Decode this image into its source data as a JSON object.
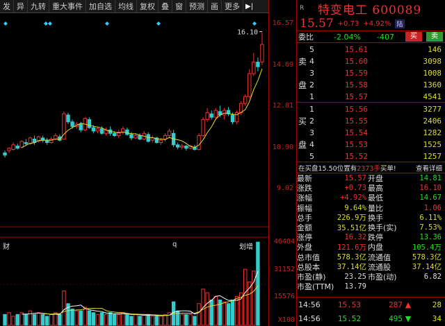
{
  "toolbar": {
    "items": [
      "发",
      "异",
      "九转",
      "重大事件",
      "加自选",
      "均线",
      "复权",
      "叠",
      "窗",
      "预测",
      "画",
      "更多"
    ],
    "arrow": "▶|"
  },
  "axis": {
    "price_ticks": [
      "16.57",
      "14.69",
      "12.81",
      "10.90",
      "9.02"
    ],
    "volume_ticks": [
      "46404",
      "31152",
      "15576"
    ],
    "volume_unit": "X100",
    "high_marker": "16.10"
  },
  "events": [
    "财",
    "q",
    "划增"
  ],
  "header": {
    "r_label": "R",
    "name": "特变电工",
    "code": "600089",
    "price": "15.57",
    "change": "+0.73",
    "change_pct": "+4.92%",
    "badge": "陆"
  },
  "weibi": {
    "label": "委比",
    "pct": "-2.04%",
    "diff": "-407",
    "buy": "买",
    "sell": "卖"
  },
  "orderbook": {
    "ask_side": [
      "卖",
      "盘"
    ],
    "bid_side": [
      "买",
      "盘"
    ],
    "asks": [
      {
        "lvl": "5",
        "price": "15.61",
        "vol": "146"
      },
      {
        "lvl": "4",
        "price": "15.60",
        "vol": "3098"
      },
      {
        "lvl": "3",
        "price": "15.59",
        "vol": "1008"
      },
      {
        "lvl": "2",
        "price": "15.58",
        "vol": "1360"
      },
      {
        "lvl": "1",
        "price": "15.57",
        "vol": "4541"
      }
    ],
    "bids": [
      {
        "lvl": "1",
        "price": "15.56",
        "vol": "3277"
      },
      {
        "lvl": "2",
        "price": "15.55",
        "vol": "2406"
      },
      {
        "lvl": "3",
        "price": "15.54",
        "vol": "1282"
      },
      {
        "lvl": "4",
        "price": "15.53",
        "vol": "1525"
      },
      {
        "lvl": "5",
        "price": "15.52",
        "vol": "1257"
      }
    ]
  },
  "inner": {
    "prefix": "在买盘15.50位置有",
    "qty": "2373手",
    "suffix": "买单!",
    "link": "查看详细"
  },
  "stats": [
    {
      "k": "最新",
      "v": "15.57",
      "vc": "red",
      "k2": "开盘",
      "v2": "14.81",
      "v2c": "green"
    },
    {
      "k": "涨跌",
      "v": "+0.73",
      "vc": "red",
      "k2": "最高",
      "v2": "16.10",
      "v2c": "red"
    },
    {
      "k": "涨幅",
      "v": "+4.92%",
      "vc": "red",
      "k2": "最低",
      "v2": "14.67",
      "v2c": "green"
    },
    {
      "k": "振幅",
      "v": "9.64%",
      "vc": "yellow",
      "k2": "量比",
      "v2": "1.06",
      "v2c": "red"
    },
    {
      "k": "总手",
      "v": "226.9万",
      "vc": "yellow",
      "k2": "换手",
      "v2": "6.11%",
      "v2c": "yellow"
    },
    {
      "k": "金额",
      "v": "35.51亿",
      "vc": "yellow",
      "k2": "换手(实)",
      "v2": "7.53%",
      "v2c": "yellow"
    },
    {
      "k": "涨停",
      "v": "16.32",
      "vc": "red",
      "k2": "跌停",
      "v2": "13.36",
      "v2c": "green"
    },
    {
      "k": "外盘",
      "v": "121.6万",
      "vc": "red",
      "k2": "内盘",
      "v2": "105.4万",
      "v2c": "green"
    },
    {
      "k": "总市值",
      "v": "578.3亿",
      "vc": "yellow",
      "k2": "流通值",
      "v2": "578.3亿",
      "v2c": "yellow"
    },
    {
      "k": "总股本",
      "v": "37.14亿",
      "vc": "yellow",
      "k2": "流通股",
      "v2": "37.14亿",
      "v2c": "yellow"
    },
    {
      "k": "市盈(静)",
      "v": "23.25",
      "vc": "white",
      "k2": "市盈(动)",
      "v2": "6.82",
      "v2c": "white"
    },
    {
      "k": "市盈(TTM)",
      "v": "13.79",
      "vc": "white",
      "k2": "",
      "v2": "",
      "v2c": "white"
    }
  ],
  "ticks": [
    {
      "t": "14:56",
      "p": "15.53",
      "v": "287",
      "dir": "up",
      "n": "28"
    },
    {
      "t": "14:56",
      "p": "15.52",
      "v": "495",
      "dir": "down",
      "n": "34"
    }
  ],
  "colors": {
    "up": "#e33",
    "down": "#2d2",
    "ma": "#dd3",
    "ma2": "#fff",
    "accent": "#a00"
  },
  "chart_data": {
    "type": "candlestick",
    "price_range": [
      9.02,
      16.57
    ],
    "volume_range": [
      0,
      46404
    ],
    "candles": [
      {
        "o": 10.85,
        "c": 10.75,
        "h": 10.95,
        "l": 10.65
      },
      {
        "o": 10.95,
        "c": 11.05,
        "h": 11.1,
        "l": 10.85
      },
      {
        "o": 11.0,
        "c": 11.2,
        "h": 11.3,
        "l": 10.95
      },
      {
        "o": 11.15,
        "c": 11.05,
        "h": 11.25,
        "l": 11.0
      },
      {
        "o": 11.1,
        "c": 11.35,
        "h": 11.4,
        "l": 11.05
      },
      {
        "o": 11.3,
        "c": 11.25,
        "h": 11.45,
        "l": 11.15
      },
      {
        "o": 11.25,
        "c": 11.5,
        "h": 11.55,
        "l": 11.2
      },
      {
        "o": 11.45,
        "c": 11.3,
        "h": 11.6,
        "l": 11.2
      },
      {
        "o": 11.35,
        "c": 11.55,
        "h": 11.6,
        "l": 11.3
      },
      {
        "o": 11.5,
        "c": 11.4,
        "h": 11.6,
        "l": 11.3
      },
      {
        "o": 11.4,
        "c": 11.3,
        "h": 11.5,
        "l": 11.2
      },
      {
        "o": 11.3,
        "c": 11.45,
        "h": 11.55,
        "l": 11.25
      },
      {
        "o": 11.45,
        "c": 11.6,
        "h": 11.7,
        "l": 11.4
      },
      {
        "o": 11.55,
        "c": 11.4,
        "h": 11.65,
        "l": 11.35
      },
      {
        "o": 11.45,
        "c": 12.55,
        "h": 12.65,
        "l": 11.45
      },
      {
        "o": 12.5,
        "c": 12.2,
        "h": 12.6,
        "l": 12.1
      },
      {
        "o": 12.2,
        "c": 12.0,
        "h": 12.3,
        "l": 11.9
      },
      {
        "o": 12.0,
        "c": 12.1,
        "h": 12.2,
        "l": 11.9
      },
      {
        "o": 12.1,
        "c": 11.85,
        "h": 12.2,
        "l": 11.75
      },
      {
        "o": 11.85,
        "c": 12.35,
        "h": 12.4,
        "l": 11.8
      },
      {
        "o": 12.3,
        "c": 11.95,
        "h": 12.4,
        "l": 11.9
      },
      {
        "o": 11.95,
        "c": 11.8,
        "h": 12.05,
        "l": 11.7
      },
      {
        "o": 11.8,
        "c": 11.9,
        "h": 12.0,
        "l": 11.7
      },
      {
        "o": 11.9,
        "c": 11.7,
        "h": 12.0,
        "l": 11.65
      },
      {
        "o": 11.7,
        "c": 11.85,
        "h": 11.95,
        "l": 11.6
      },
      {
        "o": 11.85,
        "c": 11.7,
        "h": 12.0,
        "l": 11.6
      },
      {
        "o": 11.7,
        "c": 11.6,
        "h": 11.8,
        "l": 11.55
      },
      {
        "o": 11.6,
        "c": 11.75,
        "h": 11.85,
        "l": 11.5
      },
      {
        "o": 11.75,
        "c": 11.9,
        "h": 12.0,
        "l": 11.65
      },
      {
        "o": 11.85,
        "c": 11.65,
        "h": 11.95,
        "l": 11.6
      },
      {
        "o": 11.65,
        "c": 11.5,
        "h": 11.75,
        "l": 11.4
      },
      {
        "o": 11.5,
        "c": 11.6,
        "h": 11.7,
        "l": 11.45
      },
      {
        "o": 11.6,
        "c": 11.45,
        "h": 11.7,
        "l": 11.4
      },
      {
        "o": 11.45,
        "c": 11.7,
        "h": 11.8,
        "l": 11.4
      },
      {
        "o": 11.65,
        "c": 11.35,
        "h": 11.75,
        "l": 11.3
      },
      {
        "o": 11.4,
        "c": 11.5,
        "h": 11.6,
        "l": 11.3
      },
      {
        "o": 11.5,
        "c": 11.3,
        "h": 11.55,
        "l": 11.25
      },
      {
        "o": 11.3,
        "c": 11.4,
        "h": 11.5,
        "l": 11.2
      },
      {
        "o": 11.45,
        "c": 11.6,
        "h": 11.7,
        "l": 11.35
      },
      {
        "o": 11.6,
        "c": 11.8,
        "h": 11.9,
        "l": 11.5
      },
      {
        "o": 11.7,
        "c": 11.2,
        "h": 11.85,
        "l": 11.1
      },
      {
        "o": 11.2,
        "c": 11.1,
        "h": 11.3,
        "l": 11.0
      },
      {
        "o": 11.1,
        "c": 11.15,
        "h": 11.25,
        "l": 11.0
      },
      {
        "o": 11.15,
        "c": 11.05,
        "h": 11.2,
        "l": 10.95
      },
      {
        "o": 11.05,
        "c": 11.15,
        "h": 11.2,
        "l": 11.0
      },
      {
        "o": 11.1,
        "c": 11.0,
        "h": 11.2,
        "l": 10.95
      },
      {
        "o": 11.0,
        "c": 11.6,
        "h": 11.7,
        "l": 10.95
      },
      {
        "o": 11.6,
        "c": 12.3,
        "h": 12.4,
        "l": 11.55
      },
      {
        "o": 12.3,
        "c": 12.6,
        "h": 12.8,
        "l": 12.2
      },
      {
        "o": 12.55,
        "c": 12.4,
        "h": 12.7,
        "l": 12.3
      },
      {
        "o": 12.4,
        "c": 12.7,
        "h": 12.8,
        "l": 12.3
      },
      {
        "o": 12.65,
        "c": 12.5,
        "h": 12.9,
        "l": 12.4
      },
      {
        "o": 12.5,
        "c": 12.7,
        "h": 12.8,
        "l": 12.3
      },
      {
        "o": 12.7,
        "c": 12.55,
        "h": 12.85,
        "l": 12.45
      },
      {
        "o": 12.5,
        "c": 12.2,
        "h": 12.6,
        "l": 12.1
      },
      {
        "o": 12.2,
        "c": 12.6,
        "h": 12.7,
        "l": 12.1
      },
      {
        "o": 12.6,
        "c": 13.0,
        "h": 13.1,
        "l": 12.5
      },
      {
        "o": 13.0,
        "c": 13.3,
        "h": 13.4,
        "l": 12.9
      },
      {
        "o": 13.3,
        "c": 14.3,
        "h": 14.5,
        "l": 13.2
      },
      {
        "o": 14.3,
        "c": 14.8,
        "h": 15.2,
        "l": 14.2
      },
      {
        "o": 14.8,
        "c": 14.6,
        "h": 15.0,
        "l": 14.4
      },
      {
        "o": 14.81,
        "c": 15.57,
        "h": 16.1,
        "l": 14.67
      }
    ],
    "volumes": [
      6,
      7,
      5,
      6,
      7,
      6,
      8,
      6,
      7,
      6,
      5,
      6,
      7,
      6,
      19,
      12,
      9,
      8,
      8,
      10,
      8,
      7,
      6,
      7,
      6,
      7,
      6,
      6,
      7,
      6,
      5,
      6,
      5,
      6,
      6,
      5,
      5,
      5,
      6,
      7,
      13,
      8,
      6,
      6,
      6,
      5,
      12,
      20,
      18,
      14,
      16,
      14,
      13,
      12,
      14,
      16,
      18,
      31,
      24,
      30,
      46
    ]
  }
}
